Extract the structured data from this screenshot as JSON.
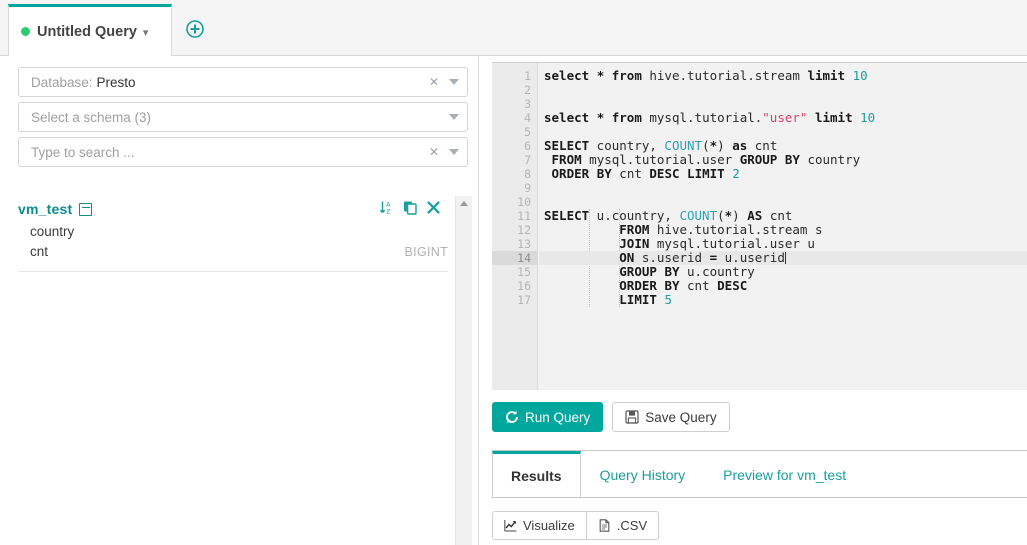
{
  "tabbar": {
    "query_tab_label": "Untitled Query",
    "status_dot_color": "#2ecc71",
    "accent_color": "#00a79d",
    "add_tab_icon": "plus-circle-icon",
    "caret_icon": "chevron-down-icon"
  },
  "sidebar": {
    "database_field": {
      "placeholder": "Database:",
      "value": "Presto",
      "clear_icon": "close-icon",
      "caret_icon": "caret-down-icon"
    },
    "schema_field": {
      "placeholder": "Select a schema (3)",
      "value": "",
      "caret_icon": "caret-down-icon"
    },
    "search_field": {
      "placeholder": "Type to search ...",
      "value": "",
      "clear_icon": "close-icon",
      "caret_icon": "caret-down-icon"
    },
    "tree": {
      "table_name": "vm_test",
      "collapse_icon": "collapse-minus-icon",
      "actions": [
        {
          "name": "sort-alpha-icon",
          "title": "Sort"
        },
        {
          "name": "copy-icon",
          "title": "Copy"
        },
        {
          "name": "close-icon",
          "title": "Remove"
        }
      ],
      "columns": [
        {
          "name": "country",
          "type": ""
        },
        {
          "name": "cnt",
          "type": "BIGINT"
        }
      ]
    }
  },
  "editor": {
    "active_line": 14,
    "total_lines": 17,
    "lines": [
      {
        "n": 1,
        "text": "select * from hive.tutorial.stream limit 10"
      },
      {
        "n": 2,
        "text": ""
      },
      {
        "n": 3,
        "text": ""
      },
      {
        "n": 4,
        "text": "select * from mysql.tutorial.\"user\" limit 10"
      },
      {
        "n": 5,
        "text": ""
      },
      {
        "n": 6,
        "text": "SELECT country, COUNT(*) as cnt"
      },
      {
        "n": 7,
        "text": " FROM mysql.tutorial.user GROUP BY country"
      },
      {
        "n": 8,
        "text": " ORDER BY cnt DESC LIMIT 2"
      },
      {
        "n": 9,
        "text": ""
      },
      {
        "n": 10,
        "text": ""
      },
      {
        "n": 11,
        "text": "SELECT u.country, COUNT(*) AS cnt"
      },
      {
        "n": 12,
        "text": "          FROM hive.tutorial.stream s"
      },
      {
        "n": 13,
        "text": "          JOIN mysql.tutorial.user u"
      },
      {
        "n": 14,
        "text": "          ON s.userid = u.userid"
      },
      {
        "n": 15,
        "text": "          GROUP BY u.country"
      },
      {
        "n": 16,
        "text": "          ORDER BY cnt DESC"
      },
      {
        "n": 17,
        "text": "          LIMIT 5"
      }
    ]
  },
  "actions": {
    "run_label": "Run Query",
    "run_icon": "refresh-icon",
    "save_label": "Save Query",
    "save_icon": "floppy-disk-icon"
  },
  "results": {
    "tabs": [
      {
        "label": "Results",
        "active": true
      },
      {
        "label": "Query History",
        "active": false
      },
      {
        "label": "Preview for vm_test",
        "active": false
      }
    ],
    "toolbar": [
      {
        "label": "Visualize",
        "icon": "chart-line-icon"
      },
      {
        "label": ".CSV",
        "icon": "file-icon"
      }
    ]
  }
}
